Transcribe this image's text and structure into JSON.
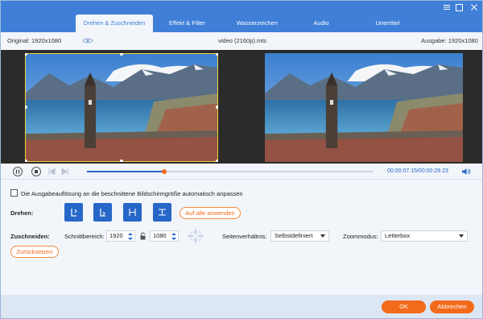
{
  "tabs": [
    {
      "label": "Drehen & Zuschneiden",
      "active": true
    },
    {
      "label": "Effekt & Filter",
      "active": false
    },
    {
      "label": "Wasserzeichen",
      "active": false
    },
    {
      "label": "Audio",
      "active": false
    },
    {
      "label": "Untertitel",
      "active": false
    }
  ],
  "window": {
    "menu_icon": "menu-lines-icon",
    "close_icon": "close-icon"
  },
  "info": {
    "original": "Original: 1920x1080",
    "filename": "video (2160p).mts",
    "output": "Ausgabe: 1920x1080"
  },
  "player": {
    "time": "00:00:07.15/00:00:29.23",
    "progress": 0.27
  },
  "options": {
    "auto_adjust_label": "Die Ausgabeauflösung an die beschnittene Bildschirmgröße automatisch anpassen",
    "auto_adjust_checked": false
  },
  "rotate": {
    "label": "Drehen:",
    "apply_all": "Auf alle anwenden",
    "buttons": [
      "rotate-left-icon",
      "rotate-right-icon",
      "flip-horizontal-icon",
      "flip-vertical-icon"
    ]
  },
  "crop": {
    "label": "Zuschneiden:",
    "area_label": "Schnittbereich:",
    "width": "1920",
    "height": "1080",
    "aspect_label": "Seitenverhältnis:",
    "aspect_value": "Selbstdefiniert",
    "zoom_label": "Zoommodus:",
    "zoom_value": "Letterbox",
    "reset": "Zurücksetzen"
  },
  "footer": {
    "ok": "OK",
    "cancel": "Abbrechen"
  },
  "colors": {
    "accent": "#3f7fd8",
    "orange": "#f26a1a",
    "button_blue": "#2667c8"
  }
}
